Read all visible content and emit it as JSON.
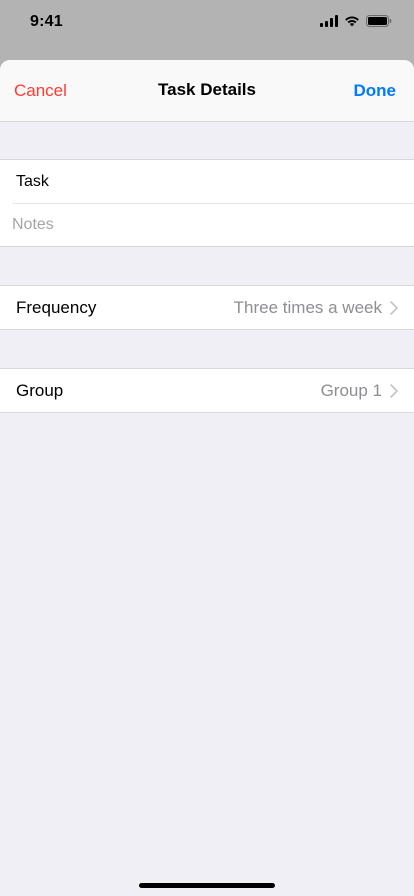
{
  "status_bar": {
    "time": "9:41"
  },
  "nav": {
    "cancel_label": "Cancel",
    "title": "Task Details",
    "done_label": "Done"
  },
  "task_section": {
    "task_value": "Task",
    "notes_placeholder": "Notes"
  },
  "frequency": {
    "label": "Frequency",
    "value": "Three times a week"
  },
  "group": {
    "label": "Group",
    "value": "Group 1"
  },
  "colors": {
    "cancel": "#ff3b30",
    "done": "#007aff",
    "secondary_text": "#8e8e93",
    "background": "#f0eff5"
  },
  "icons": [
    "signal-icon",
    "wifi-icon",
    "battery-icon",
    "chevron-right-icon"
  ]
}
